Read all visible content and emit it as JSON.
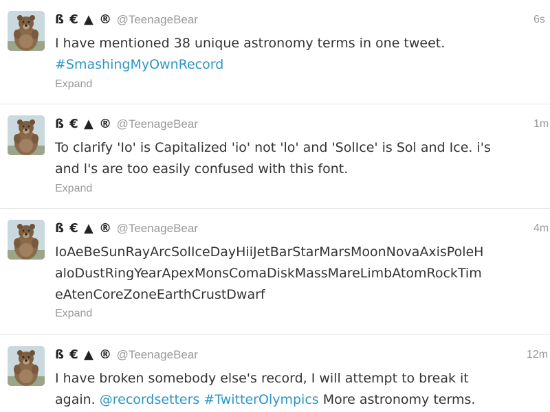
{
  "tweets": [
    {
      "name": "ß € ▲ ®",
      "handle": "@TeenageBear",
      "time": "6s",
      "line1": "I have mentioned 38 unique astronomy terms in one tweet.",
      "line2_link": "#SmashingMyOwnRecord",
      "expand": "Expand"
    },
    {
      "name": "ß € ▲ ®",
      "handle": "@TeenageBear",
      "time": "1m",
      "line1": "To clarify 'Io' is Capitalized 'io' not 'lo' and 'SolIce' is Sol and Ice. i's",
      "line2": "and l's are too easily confused with this font.",
      "expand": "Expand"
    },
    {
      "name": "ß € ▲ ®",
      "handle": "@TeenageBear",
      "time": "4m",
      "line1": "IoAeBeSunRayArcSolIceDayHiiJetBarStarMarsMoonNovaAxisPoleH",
      "line2": "aloDustRingYearApexMonsComaDiskMassMareLimbAtomRockTim",
      "line3": "eAtenCoreZoneEarthCrustDwarf",
      "expand": "Expand"
    },
    {
      "name": "ß € ▲ ®",
      "handle": "@TeenageBear",
      "time": "12m",
      "line1": "I have broken somebody else's record, I will attempt to break it",
      "line2_pre": "again. ",
      "line2_mention": "@recordsetters",
      "line2_sp": " ",
      "line2_hashtag": "#TwitterOlympics",
      "line2_post": " More astronomy terms."
    }
  ]
}
